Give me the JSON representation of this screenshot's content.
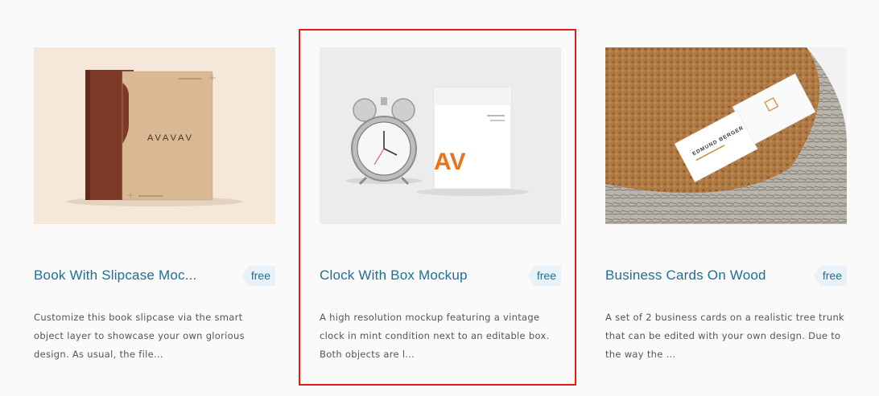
{
  "cards": [
    {
      "title": "Book With Slipcase Moc...",
      "badge": "free",
      "description": "Customize this book slipcase via the smart object layer to showcase your own glorious design. As usual, the file...",
      "thumb_text": "AVAVAV"
    },
    {
      "title": "Clock With Box Mockup",
      "badge": "free",
      "description": "A high resolution mockup featuring a vintage clock in mint condition next to an editable box. Both objects are l...",
      "thumb_text": "AV"
    },
    {
      "title": "Business Cards On Wood",
      "badge": "free",
      "description": "A set of 2 business cards on a realistic tree trunk that can be edited with your own design. Due to the way the ...",
      "thumb_text": "EDMUND BERGER"
    }
  ],
  "colors": {
    "title": "#1f6f95",
    "badge_bg": "#e8f2f8",
    "highlight": "#e21b1b",
    "accent_orange": "#e8731a"
  }
}
